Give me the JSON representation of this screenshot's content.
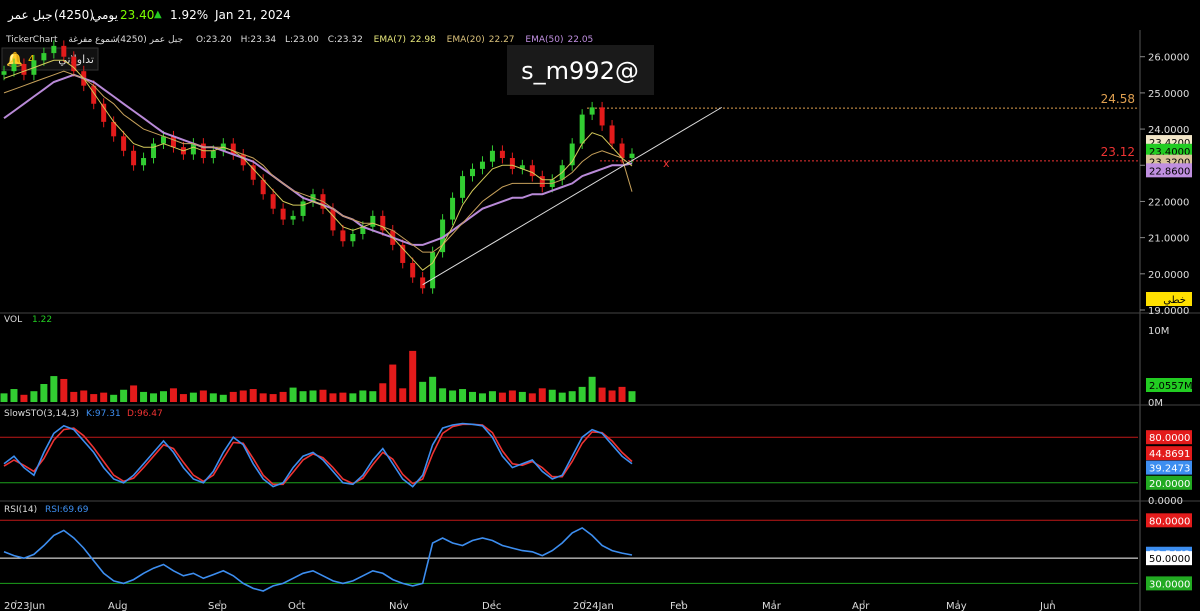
{
  "header": {
    "name": "جبل عمر",
    "code": "(4250)",
    "period": "يومي",
    "price": "23.40",
    "change_pct": "1.92%",
    "date": "Jan 21, 2024"
  },
  "info_line": {
    "brand": "TickerChart",
    "symbol": "جبل عمر (4250)",
    "candle_type": "شموع مفرغة",
    "ohlc": [
      {
        "label": "O:",
        "value": "23.20"
      },
      {
        "label": "H:",
        "value": "23.34"
      },
      {
        "label": "L:",
        "value": "23.00"
      },
      {
        "label": "C:",
        "value": "23.32"
      }
    ],
    "emas": [
      {
        "label": "EMA(7)",
        "value": "22.98",
        "color": "#e6e67a"
      },
      {
        "label": "EMA(20)",
        "value": "22.27",
        "color": "#d9c07a"
      },
      {
        "label": "EMA(50)",
        "value": "22.05",
        "color": "#c08fe0"
      }
    ]
  },
  "alerts": {
    "count": "4",
    "label": "تداولاتي"
  },
  "watermark": "s_m992@",
  "colors": {
    "up": "#32cd32",
    "down": "#e31b1b",
    "ema7": "#d4c95a",
    "ema20": "#c7a15b",
    "ema50": "#b98ad8"
  },
  "chart_data": [
    {
      "type": "candlestick",
      "panel": "price",
      "x_tick_labels": [
        "2023Jun",
        "Aug",
        "Sep",
        "Oct",
        "Nov",
        "Dec",
        "2024Jan",
        "Feb",
        "Mar",
        "Apr",
        "May",
        "Jun"
      ],
      "y_tick_labels": [
        "26.0000",
        "25.0000",
        "24.0000",
        "23.0000",
        "22.0000",
        "21.0000",
        "20.0000",
        "19.0000"
      ],
      "ylim": [
        19.0,
        26.6
      ],
      "close_series": [
        25.6,
        25.8,
        25.5,
        25.9,
        26.1,
        26.3,
        26.0,
        25.6,
        25.2,
        24.7,
        24.2,
        23.8,
        23.4,
        23.0,
        23.2,
        23.6,
        23.8,
        23.5,
        23.3,
        23.6,
        23.2,
        23.4,
        23.6,
        23.3,
        23.0,
        22.6,
        22.2,
        21.8,
        21.5,
        21.6,
        22.0,
        22.2,
        21.8,
        21.2,
        20.9,
        21.1,
        21.3,
        21.6,
        21.2,
        20.8,
        20.3,
        19.9,
        19.6,
        20.6,
        21.5,
        22.1,
        22.7,
        22.9,
        23.1,
        23.4,
        23.2,
        22.9,
        23.0,
        22.7,
        22.4,
        22.6,
        23.0,
        23.6,
        24.4,
        24.6,
        24.1,
        23.6,
        23.2,
        23.32
      ],
      "ema7_series": [
        25.4,
        25.5,
        25.6,
        25.7,
        25.8,
        25.9,
        25.9,
        25.7,
        25.4,
        25.0,
        24.6,
        24.2,
        23.9,
        23.6,
        23.5,
        23.5,
        23.6,
        23.5,
        23.4,
        23.5,
        23.4,
        23.4,
        23.5,
        23.4,
        23.2,
        22.9,
        22.6,
        22.3,
        22.0,
        21.9,
        21.9,
        22.0,
        21.9,
        21.6,
        21.3,
        21.2,
        21.3,
        21.4,
        21.3,
        21.0,
        20.7,
        20.4,
        20.1,
        20.3,
        20.8,
        21.3,
        21.9,
        22.3,
        22.6,
        22.9,
        23.0,
        23.0,
        22.9,
        22.8,
        22.6,
        22.6,
        22.8,
        23.1,
        23.6,
        23.9,
        23.8,
        23.5,
        23.2,
        22.98
      ],
      "ema20_series": [
        25.0,
        25.1,
        25.2,
        25.3,
        25.4,
        25.5,
        25.6,
        25.5,
        25.4,
        25.2,
        24.9,
        24.7,
        24.4,
        24.2,
        24.0,
        23.9,
        23.8,
        23.7,
        23.6,
        23.6,
        23.5,
        23.5,
        23.5,
        23.4,
        23.3,
        23.2,
        23.0,
        22.7,
        22.5,
        22.3,
        22.2,
        22.1,
        22.0,
        21.8,
        21.6,
        21.5,
        21.4,
        21.4,
        21.3,
        21.2,
        21.0,
        20.8,
        20.6,
        20.6,
        20.8,
        21.1,
        21.4,
        21.7,
        22.0,
        22.2,
        22.4,
        22.5,
        22.5,
        22.5,
        22.5,
        22.5,
        22.6,
        22.8,
        23.1,
        23.3,
        23.4,
        23.3,
        23.2,
        22.27
      ],
      "ema50_series": [
        24.3,
        24.5,
        24.7,
        24.9,
        25.1,
        25.3,
        25.4,
        25.5,
        25.4,
        25.3,
        25.1,
        24.9,
        24.7,
        24.5,
        24.3,
        24.1,
        23.9,
        23.8,
        23.7,
        23.6,
        23.5,
        23.5,
        23.4,
        23.3,
        23.2,
        23.1,
        22.9,
        22.7,
        22.5,
        22.3,
        22.1,
        22.0,
        21.9,
        21.8,
        21.6,
        21.5,
        21.3,
        21.2,
        21.1,
        21.0,
        20.9,
        20.8,
        20.8,
        20.9,
        21.0,
        21.2,
        21.4,
        21.6,
        21.8,
        21.9,
        22.0,
        22.1,
        22.1,
        22.2,
        22.2,
        22.3,
        22.4,
        22.5,
        22.7,
        22.8,
        22.9,
        23.0,
        23.0,
        23.05
      ],
      "levels": [
        {
          "value": 24.58,
          "label": "24.58",
          "color": "#e0a050"
        },
        {
          "value": 23.12,
          "label": "23.12",
          "color": "#e33"
        }
      ],
      "trendline": {
        "from": [
          42,
          19.7
        ],
        "to": [
          72,
          24.6
        ],
        "label": "خطي"
      },
      "price_tags": [
        {
          "value": 23.42,
          "label": "23.4200",
          "bg": "#f2e6c8",
          "fg": "#000"
        },
        {
          "value": 23.4,
          "label": "23.4000",
          "bg": "#22cc22",
          "fg": "#000"
        },
        {
          "value": 23.32,
          "label": "23.3200",
          "bg": "#d9c59a",
          "fg": "#000"
        },
        {
          "value": 22.86,
          "label": "22.8600",
          "bg": "#c08fe0",
          "fg": "#000"
        }
      ]
    },
    {
      "type": "bar",
      "panel": "volume",
      "title": "VOL",
      "value_label": "1.22",
      "y_tick_labels": [
        "10M",
        "0M"
      ],
      "ylim": [
        0,
        10
      ],
      "tag": "2.0557M",
      "values": [
        1.2,
        1.8,
        1.0,
        1.5,
        2.5,
        3.6,
        3.2,
        1.4,
        1.6,
        1.1,
        1.3,
        1.0,
        1.7,
        2.3,
        1.4,
        1.2,
        1.5,
        1.9,
        1.1,
        1.3,
        1.6,
        1.2,
        1.0,
        1.4,
        1.6,
        1.8,
        1.2,
        1.1,
        1.4,
        2.0,
        1.5,
        1.6,
        1.7,
        1.2,
        1.3,
        1.2,
        1.6,
        1.5,
        2.6,
        5.2,
        1.9,
        7.1,
        2.8,
        3.5,
        1.9,
        1.6,
        1.8,
        1.4,
        1.2,
        1.5,
        1.3,
        1.6,
        1.4,
        1.2,
        1.9,
        1.7,
        1.3,
        1.5,
        2.1,
        3.5,
        2.0,
        1.6,
        2.1,
        1.5
      ],
      "up_flags": [
        1,
        1,
        0,
        1,
        1,
        1,
        0,
        0,
        0,
        0,
        0,
        1,
        1,
        0,
        1,
        1,
        1,
        0,
        0,
        1,
        0,
        1,
        1,
        0,
        0,
        0,
        0,
        0,
        0,
        1,
        1,
        1,
        0,
        0,
        0,
        1,
        1,
        1,
        0,
        0,
        0,
        0,
        1,
        1,
        1,
        1,
        1,
        1,
        1,
        1,
        0,
        0,
        1,
        0,
        0,
        1,
        1,
        1,
        1,
        1,
        0,
        0,
        0,
        1
      ]
    },
    {
      "type": "line",
      "panel": "stochastic",
      "title": "SlowSTO(3,14,3)",
      "series": [
        {
          "name": "K:97.31",
          "color": "#3d8ef0",
          "values": [
            45,
            55,
            40,
            30,
            60,
            85,
            95,
            90,
            75,
            60,
            40,
            25,
            20,
            30,
            45,
            60,
            75,
            60,
            40,
            25,
            20,
            35,
            60,
            80,
            70,
            45,
            25,
            15,
            20,
            40,
            55,
            60,
            50,
            35,
            20,
            18,
            30,
            50,
            65,
            45,
            25,
            15,
            30,
            70,
            92,
            96,
            98,
            97,
            95,
            80,
            55,
            40,
            45,
            50,
            35,
            25,
            30,
            55,
            80,
            90,
            85,
            70,
            55,
            45
          ]
        },
        {
          "name": "D:96.47",
          "color": "#ee3333",
          "values": [
            42,
            50,
            43,
            35,
            52,
            76,
            90,
            92,
            82,
            66,
            48,
            30,
            22,
            26,
            40,
            55,
            70,
            65,
            47,
            30,
            22,
            30,
            52,
            73,
            72,
            52,
            30,
            18,
            18,
            34,
            50,
            58,
            53,
            40,
            25,
            19,
            26,
            44,
            60,
            51,
            31,
            19,
            25,
            58,
            85,
            94,
            97,
            97,
            96,
            86,
            62,
            45,
            43,
            48,
            40,
            28,
            28,
            48,
            72,
            87,
            86,
            75,
            60,
            48
          ]
        }
      ],
      "ylim": [
        0,
        100
      ],
      "y_tick_labels": [
        "0.0000"
      ],
      "tags": [
        {
          "value": 80,
          "label": "80.0000",
          "bg": "#e31b1b",
          "fg": "#fff"
        },
        {
          "value": 59,
          "label": "44.8691",
          "bg": "#e31b1b",
          "fg": "#fff"
        },
        {
          "value": 40,
          "label": "39.2473",
          "bg": "#3d8ef0",
          "fg": "#fff"
        },
        {
          "value": 20,
          "label": "20.0000",
          "bg": "#22aa22",
          "fg": "#fff"
        }
      ]
    },
    {
      "type": "line",
      "panel": "rsi",
      "title": "RSI(14)",
      "series": [
        {
          "name": "RSI:69.69",
          "color": "#3d8ef0",
          "values": [
            55,
            52,
            50,
            53,
            60,
            68,
            72,
            66,
            58,
            48,
            38,
            32,
            30,
            33,
            38,
            42,
            45,
            40,
            36,
            38,
            34,
            37,
            40,
            36,
            30,
            26,
            24,
            28,
            30,
            34,
            38,
            40,
            36,
            32,
            30,
            32,
            36,
            40,
            38,
            33,
            30,
            28,
            30,
            62,
            66,
            62,
            60,
            64,
            66,
            64,
            60,
            58,
            56,
            55,
            52,
            56,
            62,
            70,
            74,
            68,
            60,
            56,
            54,
            52.5
          ]
        }
      ],
      "ylim": [
        20,
        85
      ],
      "tags": [
        {
          "value": 80,
          "label": "80.0000",
          "bg": "#e31b1b",
          "fg": "#fff"
        },
        {
          "value": 53.5,
          "label": "53.5442",
          "bg": "#3d8ef0",
          "fg": "#fff"
        },
        {
          "value": 50,
          "label": "50.0000",
          "bg": "#ffffff",
          "fg": "#000"
        },
        {
          "value": 30,
          "label": "30.0000",
          "bg": "#22aa22",
          "fg": "#fff"
        }
      ]
    }
  ]
}
